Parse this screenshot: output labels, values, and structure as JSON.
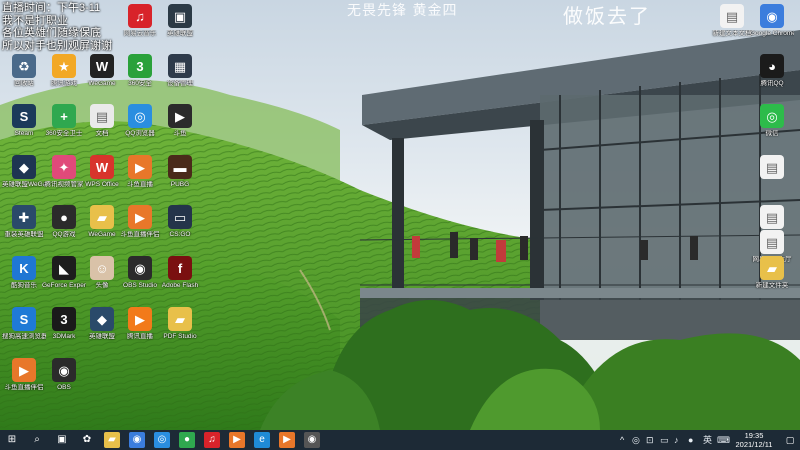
{
  "overlay": {
    "stream_note_lines": [
      "直播时间：下午3-11",
      "我不是打职业",
      "各位英雄们随缘保底",
      "所以对手也别观屏谢谢"
    ],
    "title": "无畏先锋 黄金四",
    "big_text": "做饭去了"
  },
  "desktop_icons_left": [
    {
      "name": "网易云音乐",
      "icon": "netease-music-icon",
      "color": "#d8232a",
      "glyph": "♫"
    },
    {
      "name": "英雄联盟",
      "icon": "game-icon",
      "color": "#2b3a46",
      "glyph": "▣"
    },
    {
      "name": "回收站",
      "icon": "recycle-bin-icon",
      "color": "#4a6a8a",
      "glyph": "♻"
    },
    {
      "name": "腾讯游戏",
      "icon": "tencent-games-icon",
      "color": "#f2a825",
      "glyph": "★"
    },
    {
      "name": "WeGame",
      "icon": "wegame-icon",
      "color": "#222",
      "glyph": "W"
    },
    {
      "name": "360安全",
      "icon": "360-icon",
      "color": "#2aa13a",
      "glyph": "3"
    },
    {
      "name": "设备管理",
      "icon": "device-icon",
      "color": "#2e3b4b",
      "glyph": "▦"
    },
    {
      "name": "Steam",
      "icon": "steam-icon",
      "color": "#1b3a5a",
      "glyph": "S"
    },
    {
      "name": "360安全卫士",
      "icon": "360-guard-icon",
      "color": "#2fa84f",
      "glyph": "+"
    },
    {
      "name": "文档",
      "icon": "document-icon",
      "color": "#eaeaea",
      "glyph": "▤"
    },
    {
      "name": "QQ浏览器",
      "icon": "qq-browser-icon",
      "color": "#2a8ee0",
      "glyph": "◎"
    },
    {
      "name": "斗鱼",
      "icon": "douyu-icon",
      "color": "#2b2b2b",
      "glyph": "▶"
    },
    {
      "name": "英雄联盟WeGame版",
      "icon": "lol-icon",
      "color": "#1e3552",
      "glyph": "◆"
    },
    {
      "name": "腾讯视频管家",
      "icon": "tencent-video-icon",
      "color": "#e04a7a",
      "glyph": "✦"
    },
    {
      "name": "WPS Office",
      "icon": "wps-icon",
      "color": "#d8342c",
      "glyph": "W"
    },
    {
      "name": "斗鱼直播",
      "icon": "douyu-live-icon",
      "color": "#e8772a",
      "glyph": "▶"
    },
    {
      "name": "PUBG",
      "icon": "pubg-icon",
      "color": "#4a2a1a",
      "glyph": "▬"
    },
    {
      "name": "重装英雄联盟",
      "icon": "lol-reinstall-icon",
      "color": "#2a4a6a",
      "glyph": "✚"
    },
    {
      "name": "QQ游戏",
      "icon": "qq-game-icon",
      "color": "#2b2b2b",
      "glyph": "●"
    },
    {
      "name": "WeGame",
      "icon": "wegame-folder-icon",
      "color": "#e8c04a",
      "glyph": "▰"
    },
    {
      "name": "斗鱼直播伴侣",
      "icon": "douyu-companion-icon",
      "color": "#e8772a",
      "glyph": "▶"
    },
    {
      "name": "CS:GO",
      "icon": "csgo-icon",
      "color": "#24344a",
      "glyph": "▭"
    },
    {
      "name": "酷狗音乐",
      "icon": "kugou-icon",
      "color": "#1f77d4",
      "glyph": "K"
    },
    {
      "name": "GeForce Experience",
      "icon": "nvidia-icon",
      "color": "#1d1d1d",
      "glyph": "◣"
    },
    {
      "name": "头像",
      "icon": "avatar-icon",
      "color": "#d9c2a8",
      "glyph": "☺"
    },
    {
      "name": "OBS Studio",
      "icon": "obs-icon",
      "color": "#2b2b2b",
      "glyph": "◉"
    },
    {
      "name": "Adobe Flash",
      "icon": "flash-icon",
      "color": "#7a1010",
      "glyph": "f"
    },
    {
      "name": "搜狗高速浏览器",
      "icon": "sogou-icon",
      "color": "#1f7ad6",
      "glyph": "S"
    },
    {
      "name": "3DMark",
      "icon": "3dmark-icon",
      "color": "#1a1a1a",
      "glyph": "3"
    },
    {
      "name": "英雄联盟",
      "icon": "lol-icon-2",
      "color": "#2a4a6a",
      "glyph": "◆"
    },
    {
      "name": "腾讯直播",
      "icon": "live-icon",
      "color": "#f27a1a",
      "glyph": "▶"
    },
    {
      "name": "PDF Studio",
      "icon": "folder-icon",
      "color": "#e8c04a",
      "glyph": "▰"
    },
    {
      "name": "斗鱼直播伴侣",
      "icon": "douyu-companion-icon-2",
      "color": "#e8772a",
      "glyph": "▶"
    },
    {
      "name": "OBS",
      "icon": "obs-icon-2",
      "color": "#2b2b2b",
      "glyph": "◉"
    }
  ],
  "desktop_icons_right": [
    {
      "name": "新建文本文档",
      "icon": "text-file-icon",
      "color": "#f2f2f2",
      "glyph": "▤"
    },
    {
      "name": "Google Chrome",
      "icon": "chrome-icon",
      "color": "#3b7ddd",
      "glyph": "◉"
    },
    {
      "name": "腾讯QQ",
      "icon": "qq-icon",
      "color": "#1b1b1b",
      "glyph": "◕"
    },
    {
      "name": "微信",
      "icon": "wechat-icon",
      "color": "#2dbb4a",
      "glyph": "◎"
    },
    {
      "name": "",
      "icon": "file-icon",
      "color": "#f2f2f2",
      "glyph": "▤"
    },
    {
      "name": "",
      "icon": "file-icon-2",
      "color": "#f2f2f2",
      "glyph": "▤"
    },
    {
      "name": "网易游戏大厅",
      "icon": "netease-games-icon",
      "color": "#f2f2f2",
      "glyph": "▤"
    },
    {
      "name": "新建文件夹",
      "icon": "folder-icon-2",
      "color": "#e8c04a",
      "glyph": "▰"
    }
  ],
  "taskbar": {
    "apps": [
      {
        "icon": "windows-start-icon",
        "glyph": "⊞",
        "color": "transparent"
      },
      {
        "icon": "search-icon",
        "glyph": "⌕",
        "color": "transparent"
      },
      {
        "icon": "task-view-icon",
        "glyph": "▣",
        "color": "transparent"
      },
      {
        "icon": "settings-icon",
        "glyph": "✿",
        "color": "transparent"
      },
      {
        "icon": "file-explorer-icon",
        "glyph": "▰",
        "color": "#e8c04a"
      },
      {
        "icon": "browser-icon",
        "glyph": "◉",
        "color": "#3b7ddd"
      },
      {
        "icon": "qq-browser-icon",
        "glyph": "◎",
        "color": "#2a8ee0"
      },
      {
        "icon": "360-browser-icon",
        "glyph": "●",
        "color": "#2fa84f"
      },
      {
        "icon": "netease-music-icon",
        "glyph": "♫",
        "color": "#d8232a"
      },
      {
        "icon": "douyu-icon",
        "glyph": "▶",
        "color": "#e8772a"
      },
      {
        "icon": "edge-icon",
        "glyph": "e",
        "color": "#1f8bd6"
      },
      {
        "icon": "douyu-companion-icon",
        "glyph": "▶",
        "color": "#e8772a"
      },
      {
        "icon": "obs-icon",
        "glyph": "◉",
        "color": "#555"
      }
    ],
    "tray_lang": "英",
    "time": "19:35",
    "date": "2021/12/11"
  },
  "colors": {
    "taskbar": "#1d2a36",
    "tea_green": "#4f9a2a",
    "sky": "#dfe7ee"
  }
}
